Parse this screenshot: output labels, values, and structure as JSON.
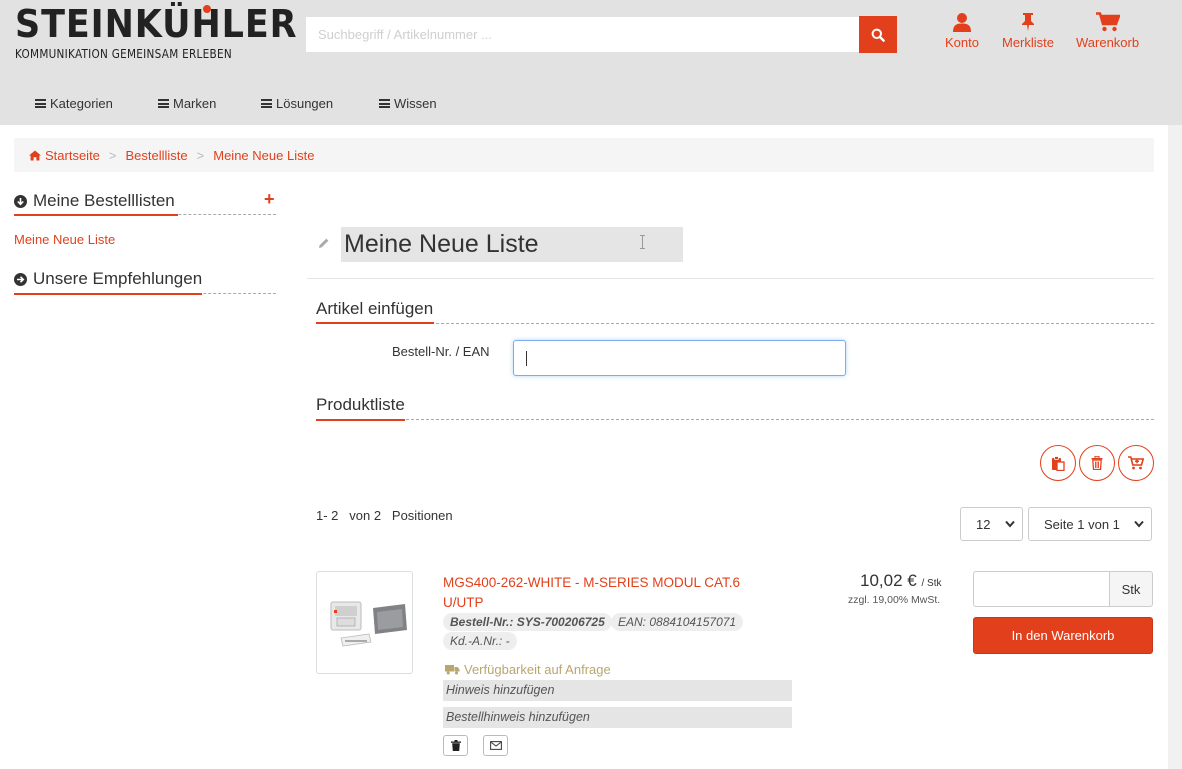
{
  "brand": {
    "name": "STEINKÜHLER",
    "tagline": "KOMMUNIKATION GEMEINSAM ERLEBEN",
    "accent": "#e2401c"
  },
  "search": {
    "placeholder": "Suchbegriff / Artikelnummer ..."
  },
  "header_links": [
    {
      "label": "Konto",
      "icon": "user-icon"
    },
    {
      "label": "Merkliste",
      "icon": "pushpin-icon"
    },
    {
      "label": "Warenkorb",
      "icon": "cart-icon"
    }
  ],
  "nav": [
    "Kategorien",
    "Marken",
    "Lösungen",
    "Wissen"
  ],
  "breadcrumb": [
    "Startseite",
    "Bestellliste",
    "Meine Neue Liste"
  ],
  "sidebar": {
    "my_lists_heading": "Meine Bestelllisten",
    "add_symbol": "+",
    "lists": [
      "Meine Neue Liste"
    ],
    "recommendations_heading": "Unsere Empfehlungen"
  },
  "list": {
    "title": "Meine Neue Liste",
    "insert_heading": "Artikel einfügen",
    "ean_label": "Bestell-Nr. / EAN",
    "ean_value": "",
    "products_heading": "Produktliste"
  },
  "pagination": {
    "range": "1- 2",
    "of_label": "von 2",
    "positions_label": "Positionen",
    "per_page": "12",
    "page": "Seite 1 von 1"
  },
  "products": [
    {
      "title": "MGS400-262-WHITE - M-SERIES MODUL CAT.6 U/UTP",
      "order_no_label": "Bestell-Nr.:",
      "order_no": "SYS-700206725",
      "ean": "EAN: 0884104157071",
      "customer_no": "Kd.-A.Nr.: -",
      "availability": "Verfügbarkeit auf Anfrage",
      "note_placeholder": "Hinweis hinzufügen",
      "order_note_placeholder": "Bestellhinweis hinzufügen",
      "price": "10,02 €",
      "unit": "/ Stk",
      "tax": "zzgl. 19,00% MwSt.",
      "qty_value": "",
      "qty_unit": "Stk",
      "cart_label": "In den Warenkorb"
    }
  ]
}
